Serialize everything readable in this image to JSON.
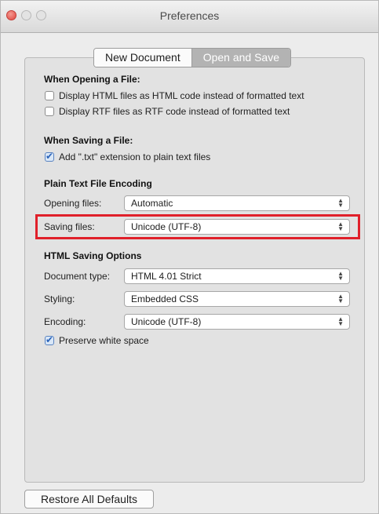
{
  "window": {
    "title": "Preferences"
  },
  "tabs": [
    {
      "label": "New Document",
      "selected": false
    },
    {
      "label": "Open and Save",
      "selected": true
    }
  ],
  "opening": {
    "heading": "When Opening a File:",
    "options": [
      {
        "label": "Display HTML files as HTML code instead of formatted text",
        "checked": false
      },
      {
        "label": "Display RTF files as RTF code instead of formatted text",
        "checked": false
      }
    ]
  },
  "saving": {
    "heading": "When Saving a File:",
    "options": [
      {
        "label": "Add \".txt\" extension to plain text files",
        "checked": true
      }
    ]
  },
  "encoding": {
    "heading": "Plain Text File Encoding",
    "opening_label": "Opening files:",
    "opening_value": "Automatic",
    "saving_label": "Saving files:",
    "saving_value": "Unicode (UTF-8)"
  },
  "html_options": {
    "heading": "HTML Saving Options",
    "doc_type_label": "Document type:",
    "doc_type_value": "HTML 4.01 Strict",
    "styling_label": "Styling:",
    "styling_value": "Embedded CSS",
    "encoding_label": "Encoding:",
    "encoding_value": "Unicode (UTF-8)",
    "preserve_label": "Preserve white space",
    "preserve_checked": true
  },
  "footer": {
    "restore_label": "Restore All Defaults"
  },
  "colors": {
    "highlight": "#e0202a",
    "selected_tab": "#b3b3b3",
    "close_button": "#e0443e"
  }
}
